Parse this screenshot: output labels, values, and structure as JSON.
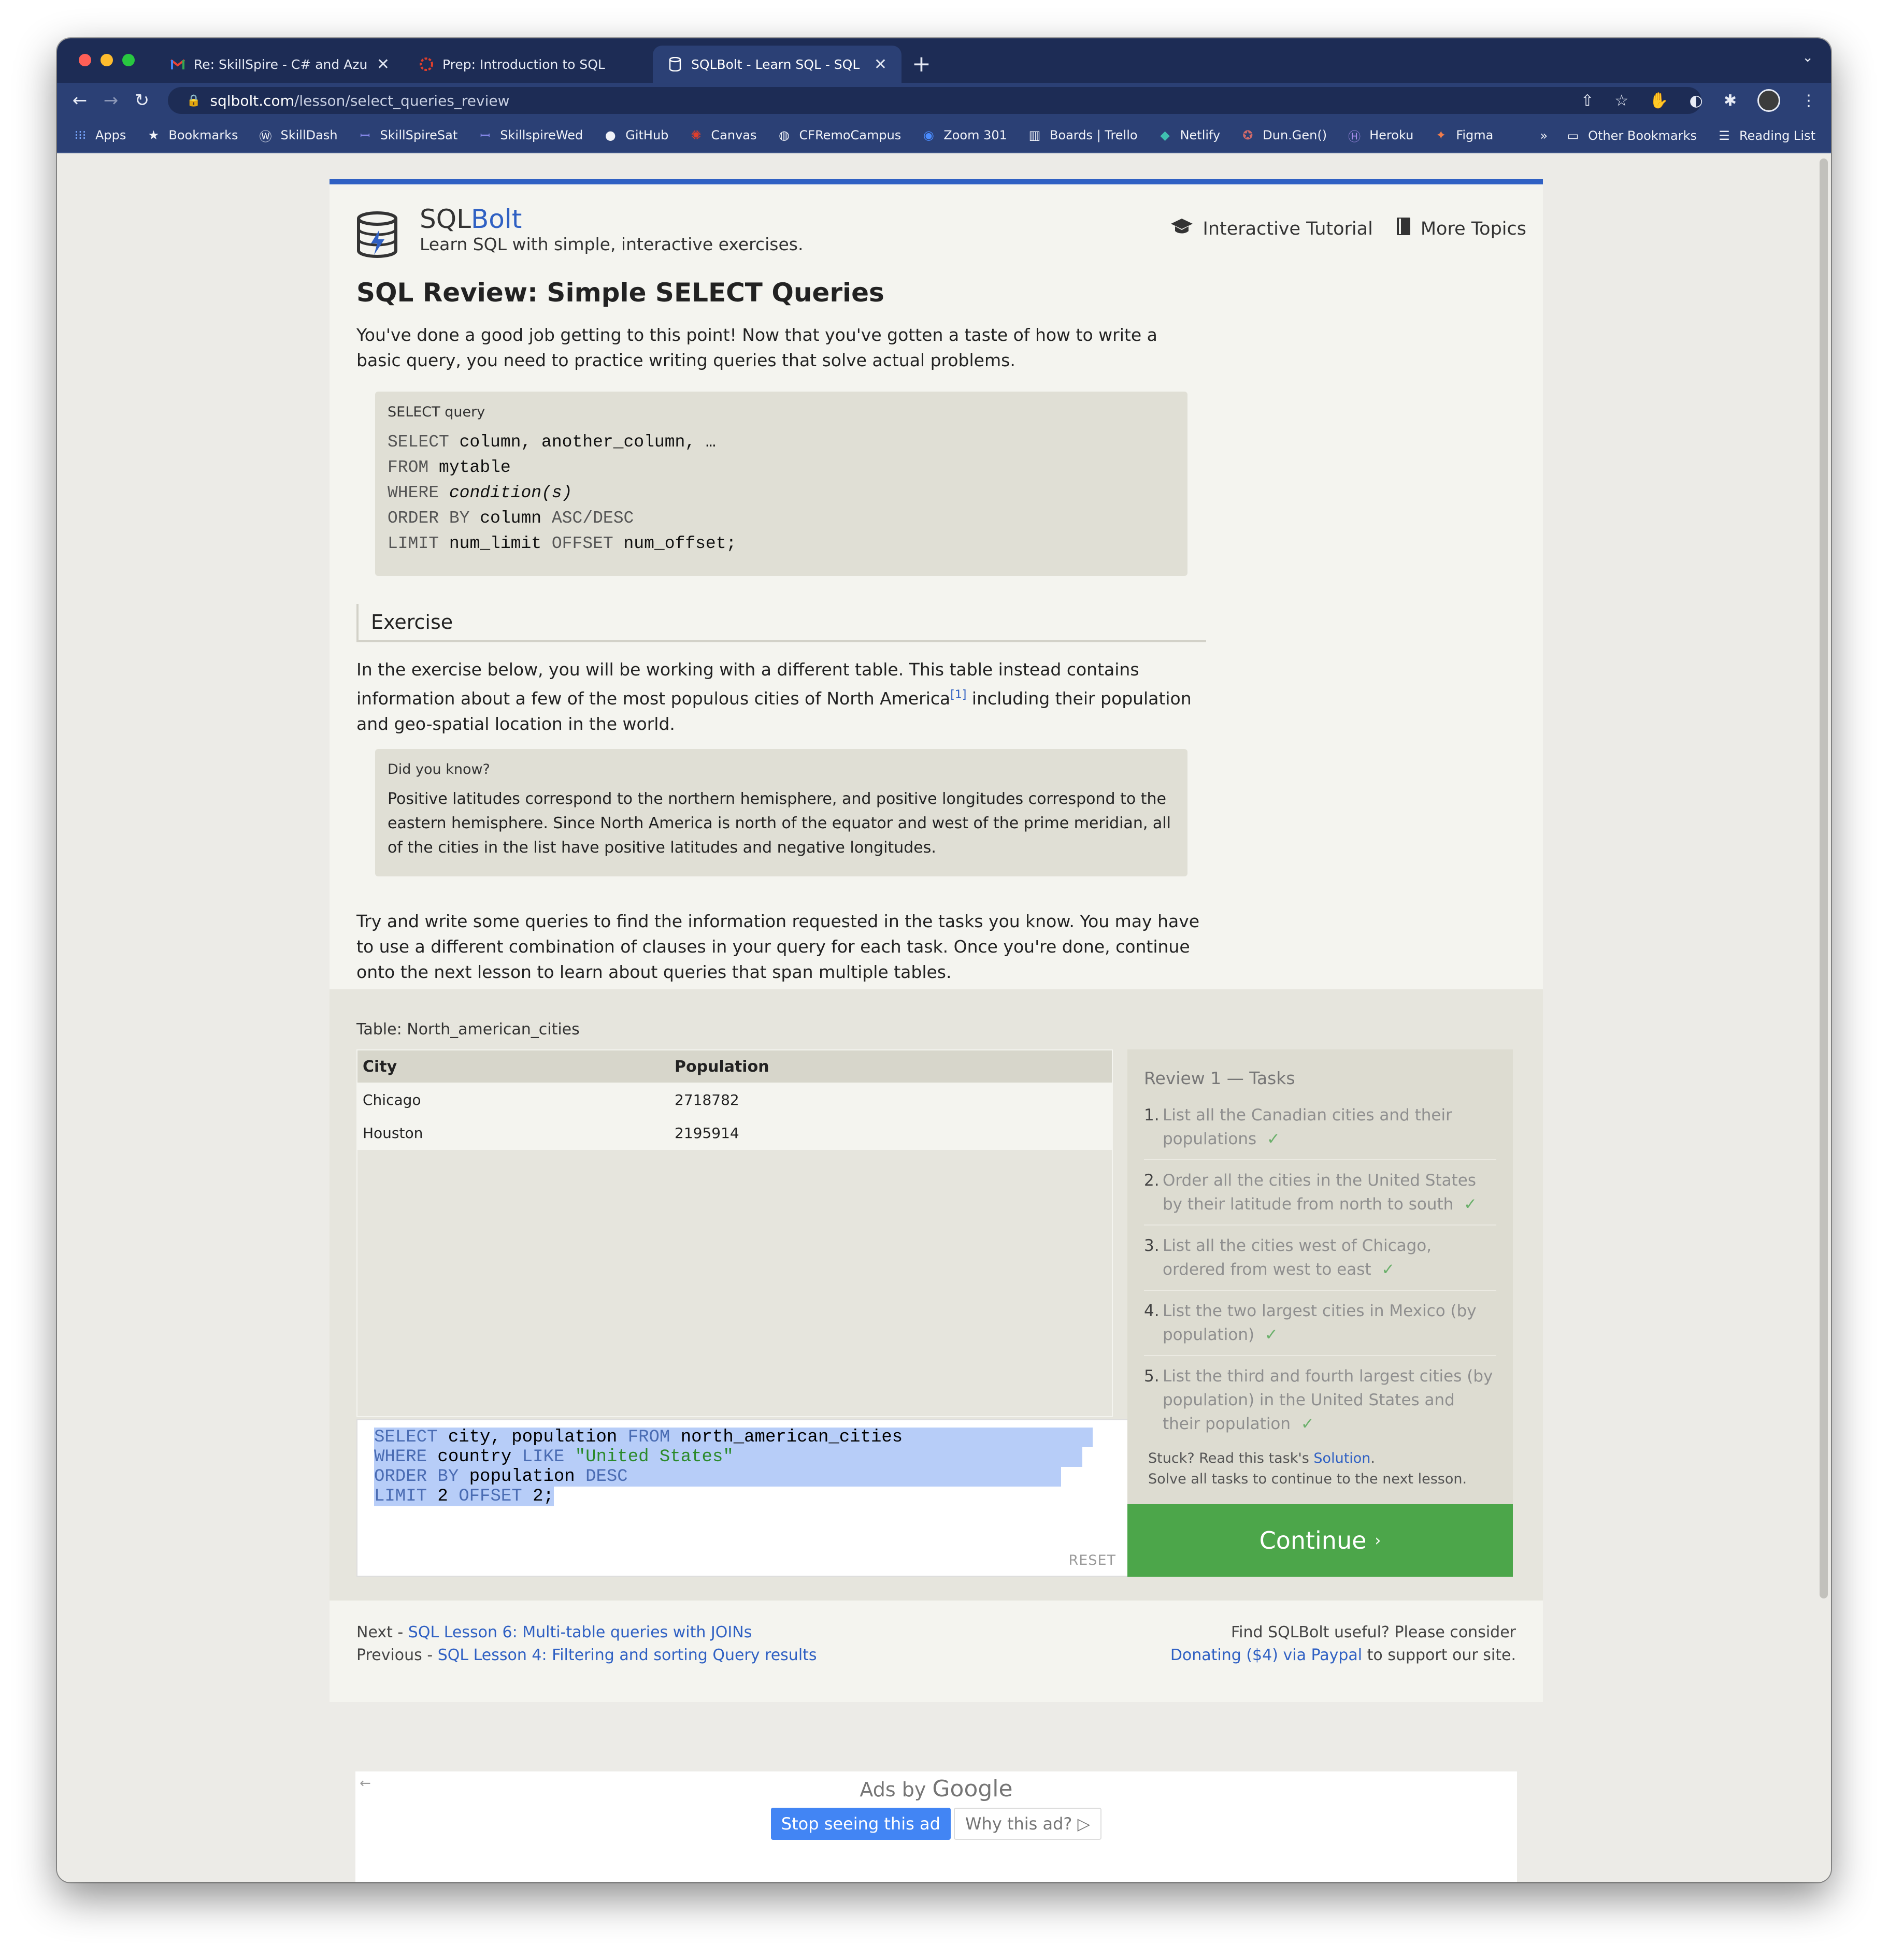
{
  "browser": {
    "tabs": [
      {
        "label": "Re: SkillSpire - C# and Azure -",
        "icon": "gmail-icon"
      },
      {
        "label": "Prep: Introduction to SQL",
        "icon": "canvas-icon"
      },
      {
        "label": "SQLBolt - Learn SQL - SQL Re",
        "icon": "sqlbolt-icon"
      }
    ],
    "url_host": "sqlbolt.com",
    "url_path": "/lesson/select_queries_review",
    "bookmarks": [
      "Apps",
      "Bookmarks",
      "SkillDash",
      "SkillSpireSat",
      "SkillspireWed",
      "GitHub",
      "Canvas",
      "CFRemoCampus",
      "Zoom 301",
      "Boards | Trello",
      "Netlify",
      "Dun.Gen()",
      "Heroku",
      "Figma"
    ],
    "bookmarks_overflow": "»",
    "other_bookmarks": "Other Bookmarks",
    "reading_list": "Reading List"
  },
  "site": {
    "brand_sql": "SQL",
    "brand_bolt": "Bolt",
    "tagline": "Learn SQL with simple, interactive exercises.",
    "nav_tutorial": "Interactive Tutorial",
    "nav_topics": "More Topics"
  },
  "lesson": {
    "title": "SQL Review: Simple SELECT Queries",
    "intro": "You've done a good job getting to this point! Now that you've gotten a taste of how to write a basic query, you need to practice writing queries that solve actual problems.",
    "code_caption": "SELECT query",
    "code": {
      "l1_kw": "SELECT",
      "l1_rest": " column, another_column, …",
      "l2_kw": "FROM",
      "l2_rest": " mytable",
      "l3_kw": "WHERE",
      "l3_rest": " condition(s)",
      "l4_kw": "ORDER BY",
      "l4_rest": " column ",
      "l4_kw2": "ASC/DESC",
      "l5_kw": "LIMIT",
      "l5_mid": " num_limit ",
      "l5_kw2": "OFFSET",
      "l5_rest": " num_offset;"
    },
    "exercise_heading": "Exercise",
    "exercise_text_a": "In the exercise below, you will be working with a different table. This table instead contains information about a few of the most populous cities of North America",
    "exercise_footnote": "[1]",
    "exercise_text_b": " including their population and geo-spatial location in the world.",
    "didyou_caption": "Did you know?",
    "didyou_text": "Positive latitudes correspond to the northern hemisphere, and positive longitudes correspond to the eastern hemisphere. Since North America is north of the equator and west of the prime meridian, all of the cities in the list have positive latitudes and negative longitudes.",
    "closing": "Try and write some queries to find the information requested in the tasks you know. You may have to use a different combination of clauses in your query for each task. Once you're done, continue onto the next lesson to learn about queries that span multiple tables."
  },
  "exercise": {
    "table_label": "Table: North_american_cities",
    "columns": [
      "City",
      "Population"
    ],
    "rows": [
      [
        "Chicago",
        "2718782"
      ],
      [
        "Houston",
        "2195914"
      ]
    ],
    "query": {
      "l1_kw1": "SELECT",
      "l1_a": " city, population ",
      "l1_kw2": "FROM",
      "l1_b": " north_american_cities",
      "l2_kw": "WHERE",
      "l2_a": " country ",
      "l2_kw2": "LIKE",
      "l2_a2": " ",
      "l2_str": "\"United States\"",
      "l3_kw": "ORDER BY",
      "l3_a": " population ",
      "l3_kw2": "DESC",
      "l4_kw": "LIMIT",
      "l4_a": " 2 ",
      "l4_kw2": "OFFSET",
      "l4_b": " 2;"
    },
    "reset_label": "RESET",
    "tasks_header": "Review 1 — Tasks",
    "tasks": [
      "List all the Canadian cities and their populations",
      "Order all the cities in the United States by their latitude from north to south",
      "List all the cities west of Chicago, ordered from west to east",
      "List the two largest cities in Mexico (by population)",
      "List the third and fourth largest cities (by population) in the United States and their population"
    ],
    "check": "✓",
    "stuck_a": "Stuck? Read this task's ",
    "stuck_link": "Solution",
    "stuck_b": ".",
    "solve_all": "Solve all tasks to continue to the next lesson.",
    "continue_label": "Continue",
    "continue_arrow": "›"
  },
  "footer": {
    "next_prefix": "Next - ",
    "next_link": "SQL Lesson 6: Multi-table queries with JOINs",
    "prev_prefix": "Previous - ",
    "prev_link": "SQL Lesson 4: Filtering and sorting Query results",
    "donate_a": "Find SQLBolt useful? Please consider",
    "donate_link": "Donating ($4) via Paypal",
    "donate_b": " to support our site."
  },
  "ad": {
    "ads_by": "Ads by ",
    "google": "Google",
    "stop": "Stop seeing this ad",
    "why": "Why this ad? ▷",
    "back": "←"
  }
}
